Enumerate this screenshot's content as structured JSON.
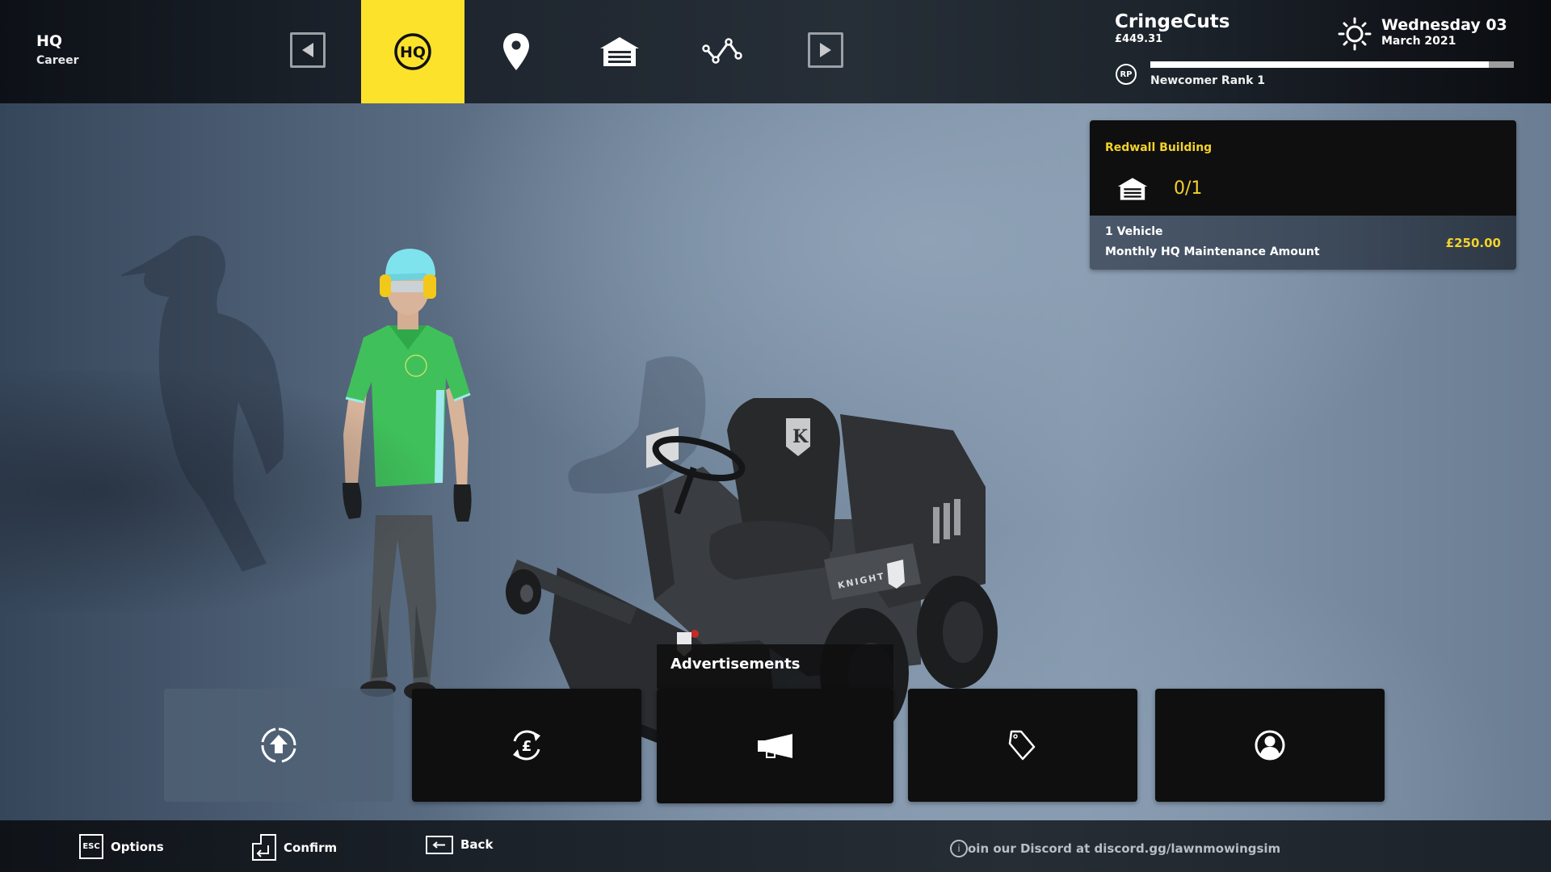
{
  "header": {
    "location_title": "HQ",
    "location_subtitle": "Career",
    "nav": [
      {
        "id": "prev",
        "icon": "triangle-left-icon"
      },
      {
        "id": "hq",
        "icon": "hq-badge-icon",
        "label": "HQ",
        "active": true
      },
      {
        "id": "map",
        "icon": "map-pin-icon"
      },
      {
        "id": "garage",
        "icon": "garage-icon"
      },
      {
        "id": "stats",
        "icon": "line-chart-icon"
      },
      {
        "id": "next",
        "icon": "triangle-right-icon"
      }
    ],
    "company_name": "CringeCuts",
    "balance": "£449.31",
    "weather_icon": "sun-icon",
    "day": "Wednesday 03",
    "month_year": "March 2021",
    "rank_badge": "RP",
    "rank_label": "Newcomer Rank 1",
    "rank_progress_percent": 93
  },
  "hq_card": {
    "title": "Redwall Building",
    "garage_icon": "garage-icon",
    "vehicle_capacity": "0/1",
    "vehicles_label": "1 Vehicle",
    "maintenance_label": "Monthly HQ Maintenance Amount",
    "maintenance_amount": "£250.00"
  },
  "scene": {
    "mower_brand": "KNIGHT",
    "mower_logo_letter": "K"
  },
  "actions": {
    "selected_label": "Advertisements",
    "tiles": [
      {
        "id": "upgrade",
        "icon": "upgrade-arrow-icon",
        "disabled": true
      },
      {
        "id": "finance",
        "icon": "currency-exchange-icon"
      },
      {
        "id": "advertisements",
        "icon": "megaphone-icon",
        "selected": true
      },
      {
        "id": "pricing",
        "icon": "price-tag-icon"
      },
      {
        "id": "staff",
        "icon": "user-profile-icon"
      }
    ]
  },
  "footer": {
    "options_key": "ESC",
    "options_label": "Options",
    "confirm_label": "Confirm",
    "back_label": "Back",
    "ticker_text": "oin our Discord at discord.gg/lawnmowingsim"
  },
  "colors": {
    "accent_yellow": "#fde22b",
    "card_text_yellow": "#f2d22c",
    "tile_dark": "#0f0f10"
  }
}
